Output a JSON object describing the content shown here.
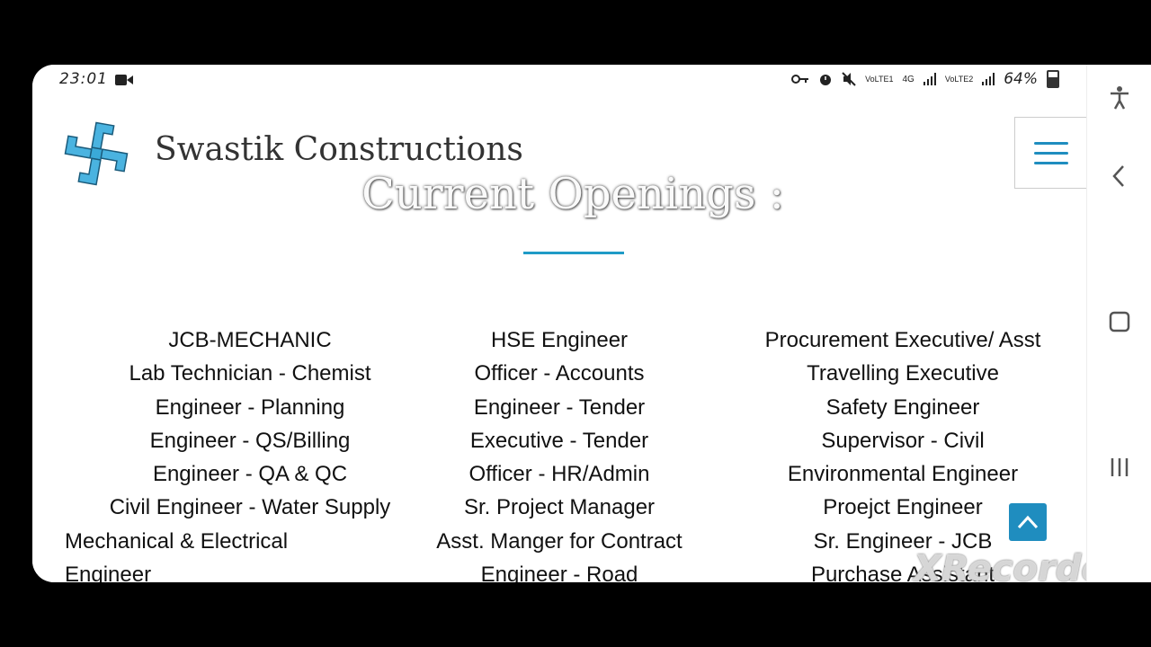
{
  "status_bar": {
    "time": "23:01",
    "net1": "VoLTE1",
    "net_type": "4G",
    "net2": "VoLTE2",
    "battery": "64%"
  },
  "site": {
    "brand": "Swastik Constructions"
  },
  "section": {
    "title": "Current Openings :"
  },
  "openings": {
    "column1": [
      "JCB-MECHANIC",
      "Lab Technician - Chemist",
      "Engineer - Planning",
      "Engineer - QS/Billing",
      "Engineer - QA & QC",
      "Civil Engineer - Water Supply",
      "Mechanical & Electrical",
      "Engineer"
    ],
    "column2": [
      "HSE Engineer",
      "Officer - Accounts",
      "Engineer - Tender",
      "Executive - Tender",
      "Officer - HR/Admin",
      "Sr. Project Manager",
      "Asst. Manger for Contract",
      "Engineer - Road"
    ],
    "column3": [
      "Procurement Executive/ Asst",
      "Travelling Executive",
      "Safety Engineer",
      "Supervisor - Civil",
      "Environmental Engineer",
      "Proejct Engineer",
      "Sr. Engineer - JCB",
      "Purchase Assistant"
    ]
  },
  "watermark": "XRecorder",
  "colors": {
    "accent": "#1f8dbf",
    "text": "#111111"
  }
}
